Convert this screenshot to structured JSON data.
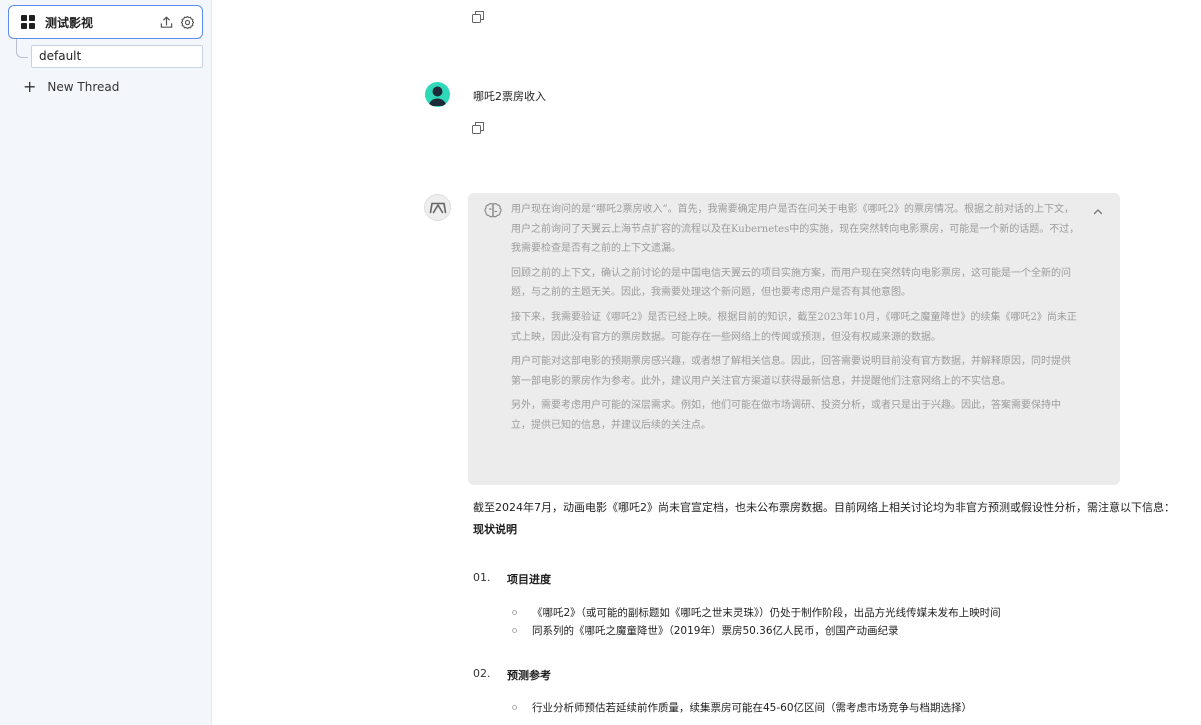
{
  "sidebar": {
    "project_title": "测试影视",
    "thread_name": "default",
    "new_thread_label": "New Thread",
    "new_thread_icon": "+"
  },
  "conversation": {
    "user_message": "哪吒2票房收入",
    "thinking": {
      "paragraphs": [
        "用户现在询问的是“哪吒2票房收入”。首先，我需要确定用户是否在问关于电影《哪吒2》的票房情况。根据之前对话的上下文，用户之前询问了天翼云上海节点扩容的流程以及在Kubernetes中的实施，现在突然转向电影票房，可能是一个新的话题。不过，我需要检查是否有之前的上下文遗漏。",
        "回顾之前的上下文，确认之前讨论的是中国电信天翼云的项目实施方案，而用户现在突然转向电影票房，这可能是一个全新的问题，与之前的主题无关。因此，我需要处理这个新问题，但也要考虑用户是否有其他意图。",
        "接下来，我需要验证《哪吒2》是否已经上映。根据目前的知识，截至2023年10月，《哪吒之魔童降世》的续集《哪吒2》尚未正式上映，因此没有官方的票房数据。可能存在一些网络上的传闻或预测，但没有权威来源的数据。",
        "用户可能对这部电影的预期票房感兴趣，或者想了解相关信息。因此，回答需要说明目前没有官方数据，并解释原因，同时提供第一部电影的票房作为参考。此外，建议用户关注官方渠道以获得最新信息，并提醒他们注意网络上的不实信息。",
        "另外，需要考虑用户可能的深层需求。例如，他们可能在做市场调研、投资分析，或者只是出于兴趣。因此，答案需要保持中立，提供已知的信息，并建议后续的关注点。"
      ]
    },
    "answer": {
      "lead": "截至2024年7月，动画电影《哪吒2》尚未官宣定档，也未公布票房数据。目前网络上相关讨论均为非官方预测或假设性分析，需注意以下信息：",
      "heading": "现状说明",
      "sections": [
        {
          "number": "01.",
          "title": "项目进度",
          "bullets": [
            "《哪吒2》（或可能的副标题如《哪吒之世末灵珠》）仍处于制作阶段，出品方光线传媒未发布上映时间",
            "同系列的《哪吒之魔童降世》（2019年）票房50.36亿人民币，创国产动画纪录"
          ]
        },
        {
          "number": "02.",
          "title": "预测参考",
          "bullets": [
            "行业分析师预估若延续前作质量，续集票房可能在45-60亿区间（需考虑市场竞争与档期选择）"
          ]
        }
      ]
    }
  }
}
